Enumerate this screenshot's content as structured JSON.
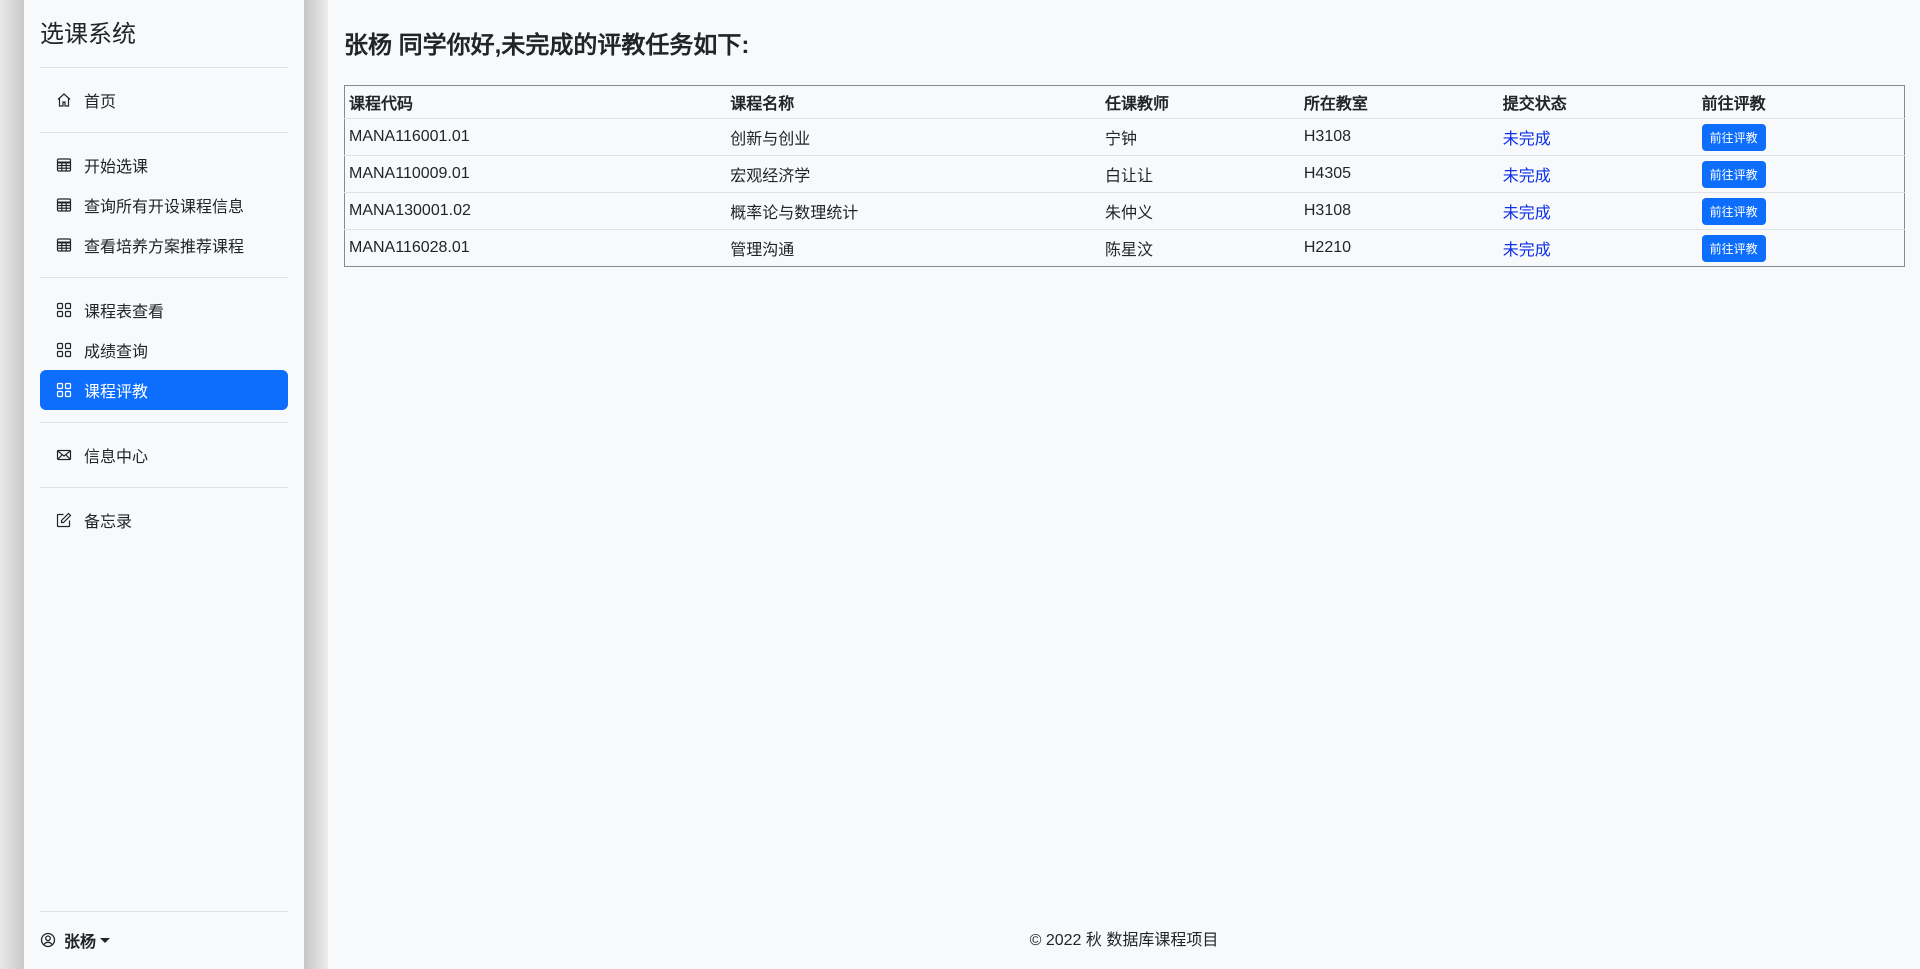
{
  "sidebar": {
    "brand": "选课系统",
    "groups": [
      [
        {
          "label": "首页",
          "icon": "home-icon"
        }
      ],
      [
        {
          "label": "开始选课",
          "icon": "table-icon"
        },
        {
          "label": "查询所有开设课程信息",
          "icon": "table-icon"
        },
        {
          "label": "查看培养方案推荐课程",
          "icon": "table-icon"
        }
      ],
      [
        {
          "label": "课程表查看",
          "icon": "grid-icon"
        },
        {
          "label": "成绩查询",
          "icon": "grid-icon"
        },
        {
          "label": "课程评教",
          "icon": "grid-icon",
          "active": true
        }
      ],
      [
        {
          "label": "信息中心",
          "icon": "envelope-icon"
        }
      ],
      [
        {
          "label": "备忘录",
          "icon": "pencil-square-icon"
        }
      ]
    ],
    "user": "张杨"
  },
  "main": {
    "greeting": "张杨 同学你好,未完成的评教任务如下:",
    "table": {
      "headers": [
        "课程代码",
        "课程名称",
        "任课教师",
        "所在教室",
        "提交状态",
        "前往评教"
      ],
      "rows": [
        {
          "code": "MANA116001.01",
          "name": "创新与创业",
          "teacher": "宁钟",
          "room": "H3108",
          "status": "未完成",
          "action": "前往评教"
        },
        {
          "code": "MANA110009.01",
          "name": "宏观经济学",
          "teacher": "白让让",
          "room": "H4305",
          "status": "未完成",
          "action": "前往评教"
        },
        {
          "code": "MANA130001.02",
          "name": "概率论与数理统计",
          "teacher": "朱仲义",
          "room": "H3108",
          "status": "未完成",
          "action": "前往评教"
        },
        {
          "code": "MANA116028.01",
          "name": "管理沟通",
          "teacher": "陈星汶",
          "room": "H2210",
          "status": "未完成",
          "action": "前往评教"
        }
      ]
    },
    "footer": "© 2022 秋 数据库课程项目"
  },
  "colors": {
    "accent": "#0d6efd",
    "status_link": "#0d30e8",
    "background": "#f8f9fa"
  }
}
